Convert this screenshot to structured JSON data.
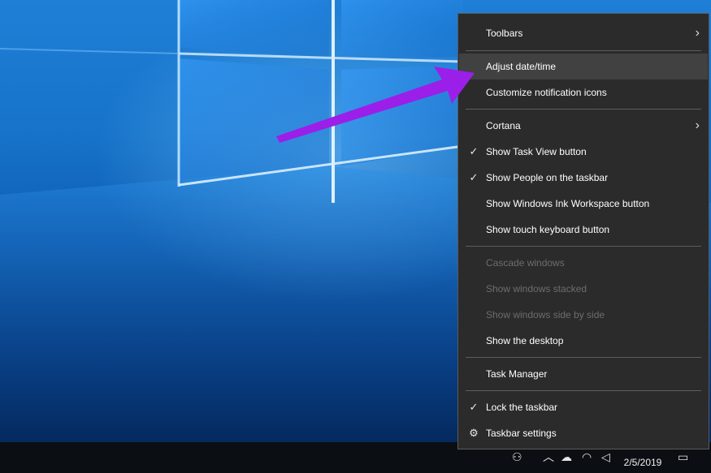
{
  "context_menu": {
    "items": [
      {
        "label": "Toolbars",
        "submenu": true
      },
      {
        "label": "Adjust date/time",
        "highlighted": true
      },
      {
        "label": "Customize notification icons"
      },
      {
        "label": "Cortana",
        "submenu": true
      },
      {
        "label": "Show Task View button",
        "checked": true
      },
      {
        "label": "Show People on the taskbar",
        "checked": true
      },
      {
        "label": "Show Windows Ink Workspace button"
      },
      {
        "label": "Show touch keyboard button"
      },
      {
        "label": "Cascade windows",
        "disabled": true
      },
      {
        "label": "Show windows stacked",
        "disabled": true
      },
      {
        "label": "Show windows side by side",
        "disabled": true
      },
      {
        "label": "Show the desktop"
      },
      {
        "label": "Task Manager"
      },
      {
        "label": "Lock the taskbar",
        "checked": true
      },
      {
        "label": "Taskbar settings",
        "icon": "gear-icon"
      }
    ],
    "check_glyph": "✓",
    "chevron_glyph": "›",
    "gear_glyph": "⚙"
  },
  "taskbar": {
    "date": "2/5/2019",
    "tray_icons": [
      "people-icon",
      "chevron-up-icon",
      "onedrive-cloud-icon",
      "wifi-icon",
      "volume-icon",
      "action-center-icon"
    ]
  },
  "annotation": {
    "arrow_color": "#9b1fe8"
  },
  "colors": {
    "menu_background": "#2b2b2b",
    "menu_hover": "#414141",
    "disabled_text": "#6d6d6d"
  }
}
